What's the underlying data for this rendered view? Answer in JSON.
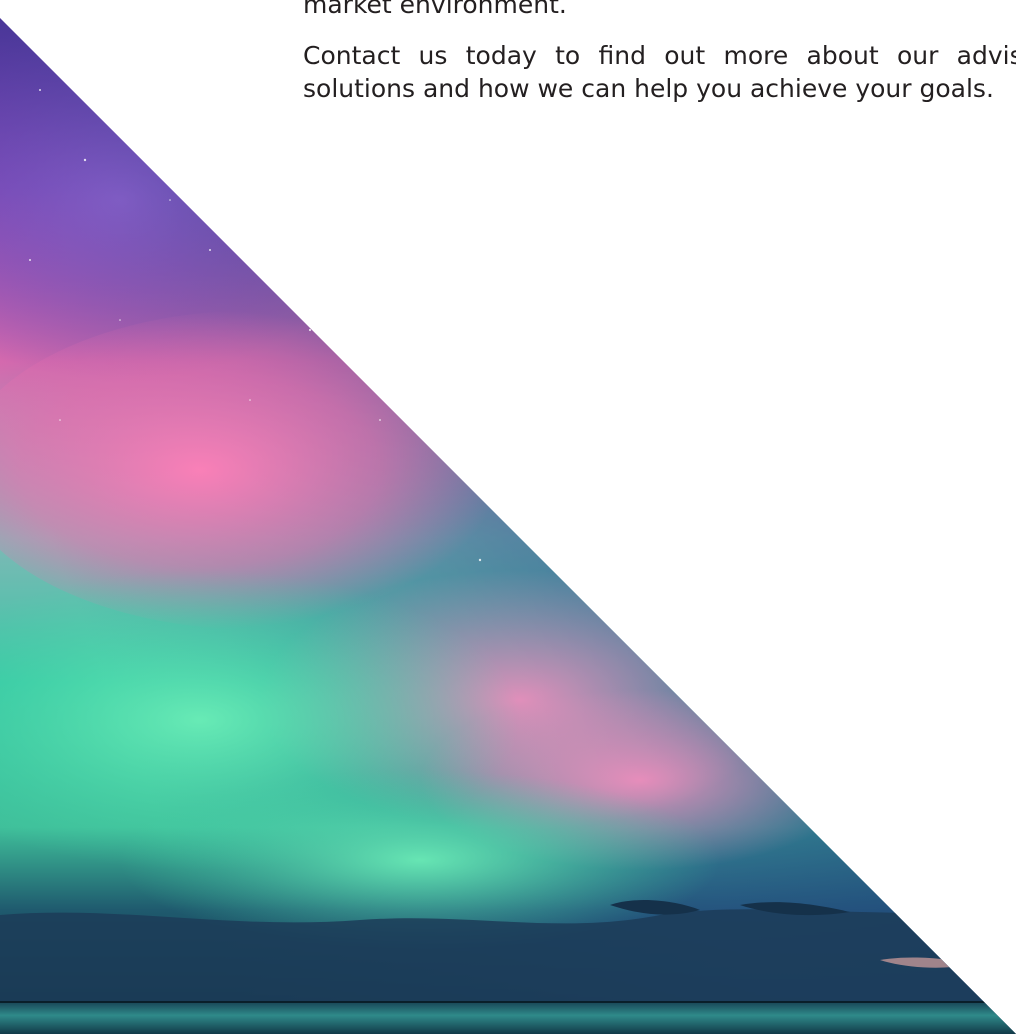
{
  "document": {
    "paragraph_1_tail": "market environment.",
    "paragraph_2": "Contact us today to find out more about our advisory solutions and how we can help you achieve your goals."
  },
  "colors": {
    "text": "#231f20",
    "background": "#ffffff",
    "aurora_violet": "#6a3fb0",
    "aurora_pink": "#f07bb0",
    "aurora_green": "#45d6a8",
    "night_blue": "#1e4a7a",
    "sea": "#0f2f3f"
  },
  "image": {
    "subject": "aurora-borealis-over-sea"
  }
}
